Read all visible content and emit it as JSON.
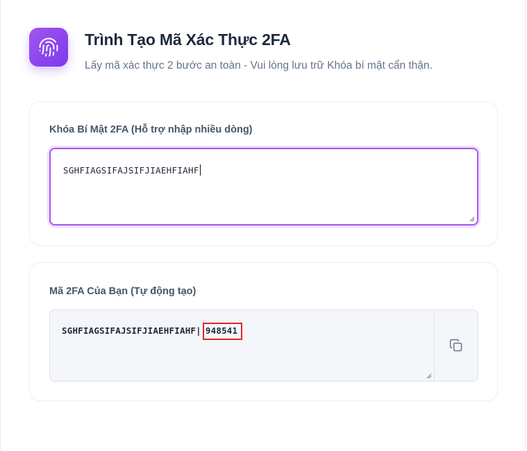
{
  "header": {
    "logo_icon": "fingerprint-icon",
    "title": "Trình Tạo Mã Xác Thực 2FA",
    "subtitle": "Lấy mã xác thực 2 bước an toàn - Vui lòng lưu trữ Khóa bí mật cẩn thận."
  },
  "secret_card": {
    "label": "Khóa Bí Mật 2FA (Hỗ trợ nhập nhiều dòng)",
    "value": "SGHFIAGSIFAJSIFJIAEHFIAHF"
  },
  "output_card": {
    "label": "Mã 2FA Của Bạn (Tự động tạo)",
    "secret": "SGHFIAGSIFAJSIFJIAEHFIAHF",
    "separator": "|",
    "code": "948541",
    "copy_icon": "copy-icon"
  },
  "colors": {
    "accent": "#a855f7",
    "highlight": "#dc2626"
  }
}
